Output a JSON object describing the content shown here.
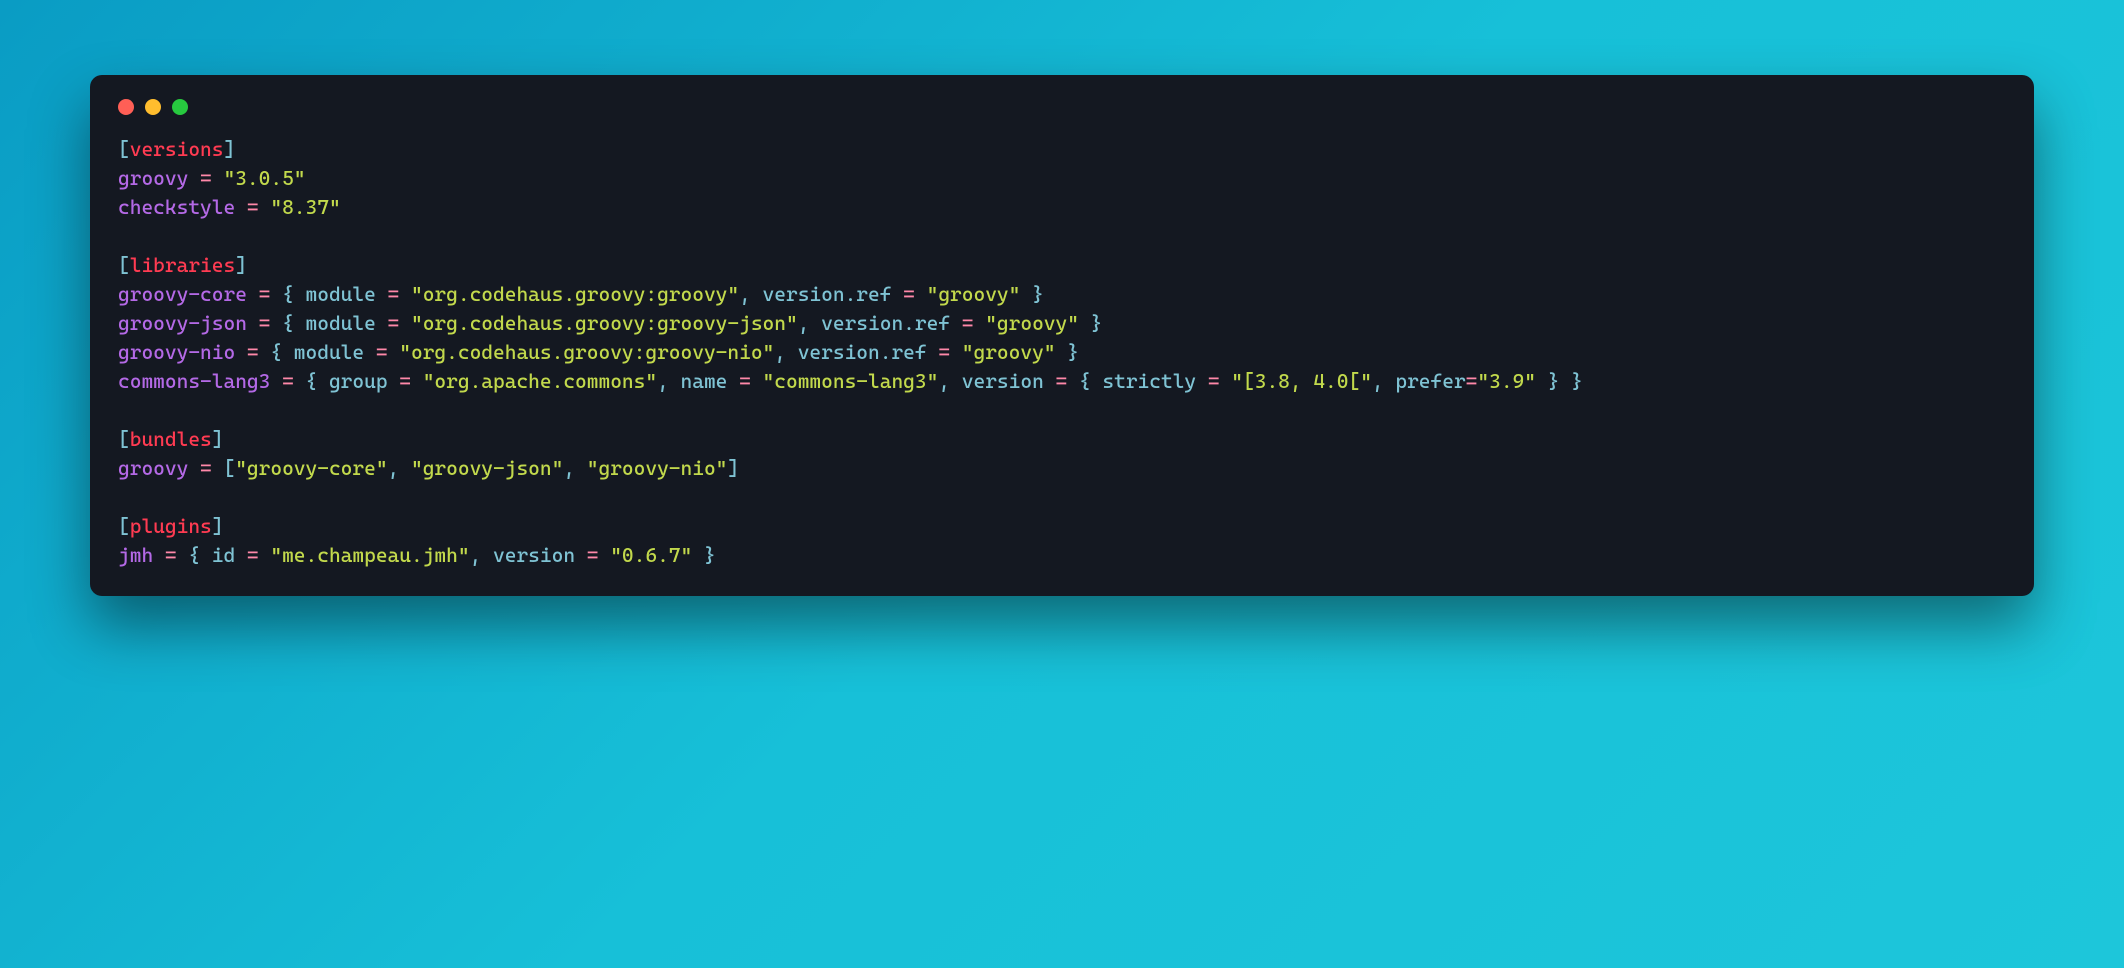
{
  "window": {
    "traffic_lights": [
      "close",
      "minimize",
      "zoom"
    ]
  },
  "code": {
    "sections": {
      "versions": "versions",
      "libraries": "libraries",
      "bundles": "bundles",
      "plugins": "plugins"
    },
    "versions": {
      "groovy_key": "groovy",
      "groovy_val": "\"3.0.5\"",
      "checkstyle_key": "checkstyle",
      "checkstyle_val": "\"8.37\""
    },
    "libraries": {
      "core_key": "groovy-core",
      "core_module_attr": "module",
      "core_module_val": "\"org.codehaus.groovy:groovy\"",
      "core_ver_attr": "version.ref",
      "core_ver_val": "\"groovy\"",
      "json_key": "groovy-json",
      "json_module_attr": "module",
      "json_module_val": "\"org.codehaus.groovy:groovy-json\"",
      "json_ver_attr": "version.ref",
      "json_ver_val": "\"groovy\"",
      "nio_key": "groovy-nio",
      "nio_module_attr": "module",
      "nio_module_val": "\"org.codehaus.groovy:groovy-nio\"",
      "nio_ver_attr": "version.ref",
      "nio_ver_val": "\"groovy\"",
      "cl3_key": "commons-lang3",
      "cl3_group_attr": "group",
      "cl3_group_val": "\"org.apache.commons\"",
      "cl3_name_attr": "name",
      "cl3_name_val": "\"commons-lang3\"",
      "cl3_version_attr": "version",
      "cl3_strictly_attr": "strictly",
      "cl3_strictly_val": "\"[3.8, 4.0[\"",
      "cl3_prefer_attr": "prefer",
      "cl3_prefer_val": "\"3.9\""
    },
    "bundles": {
      "groovy_key": "groovy",
      "item1": "\"groovy-core\"",
      "item2": "\"groovy-json\"",
      "item3": "\"groovy-nio\""
    },
    "plugins": {
      "jmh_key": "jmh",
      "id_attr": "id",
      "id_val": "\"me.champeau.jmh\"",
      "ver_attr": "version",
      "ver_val": "\"0.6.7\""
    },
    "sym": {
      "eq": " = ",
      "eq_tight": "=",
      "lbr": "[",
      "rbr": "]",
      "lcb": "{ ",
      "rcb": " }",
      "rcb_tight": "}",
      "comma": ", "
    }
  }
}
